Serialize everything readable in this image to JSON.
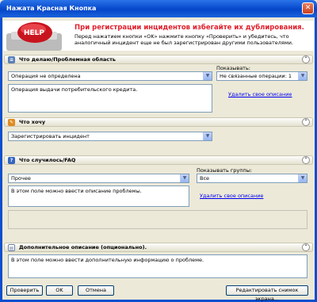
{
  "window": {
    "title": "Нажата Красная Кнопка",
    "close_label": "✕"
  },
  "banner": {
    "help_label": "HELP",
    "title": "При регистрации инцидентов избегайте их дублирования.",
    "text": "Перед нажатием кнопки «OK» нажмите кнопку «Проверить» и убедитесь, что аналогичный инцидент еще не был зарегистрирован другими пользователями."
  },
  "section_problem": {
    "title": "Что делаю/Проблемная область",
    "operation_value": "Операция не определена",
    "show_label": "Показывать:",
    "show_value": "Не связанные операции: 1",
    "description": "Операция выдачи потребительского кредита.",
    "delete_link": "Удалить свое описание"
  },
  "section_want": {
    "title": "Что хочу",
    "value": "Зарегистрировать инцидент"
  },
  "section_faq": {
    "title": "Что случилось/FAQ",
    "category_value": "Прочее",
    "show_groups_label": "Показывать группы:",
    "groups_value": "Все",
    "description": "В этом поле можно ввести описание проблемы.",
    "delete_link": "Удалить свое описание"
  },
  "section_extra": {
    "title": "Дополнительное описание (опционально).",
    "description": "В этом поле можно ввести дополнительную информацию о проблеме."
  },
  "buttons": {
    "check": "Проверить",
    "ok": "OK",
    "cancel": "Отмена",
    "edit_screenshot": "Редактировать снимок экрана..."
  },
  "icons": {
    "section_chevron": "chevron-up-icon",
    "dropdown_arrow": "chevron-down-icon"
  },
  "colors": {
    "title_bar": "#0a4fd0",
    "banner_title": "#e0202c",
    "link": "#0000ee"
  }
}
